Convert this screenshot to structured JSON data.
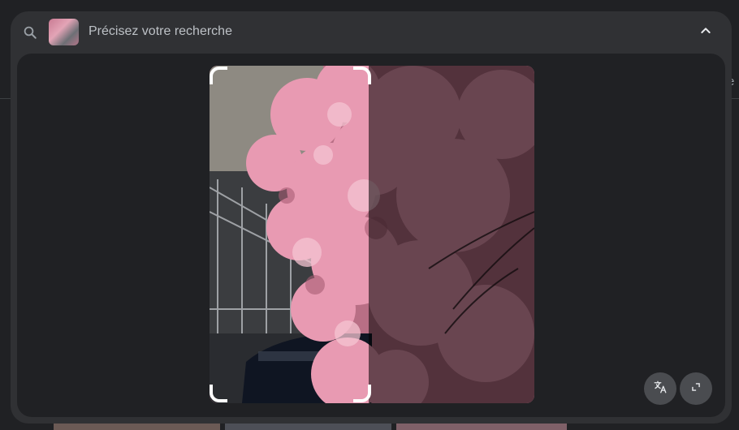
{
  "search": {
    "placeholder": "Précisez votre recherche",
    "query_thumbnail": "cherry-blossom-thumbnail"
  },
  "icons": {
    "search": "search-icon",
    "collapse": "chevron-up-icon",
    "translate": "translate-icon",
    "expand": "expand-icon"
  },
  "background": {
    "edge_text": "e"
  },
  "colors": {
    "panel": "#303134",
    "image_area": "#202124",
    "button": "#4a4c50",
    "selection": "#ffffff"
  }
}
